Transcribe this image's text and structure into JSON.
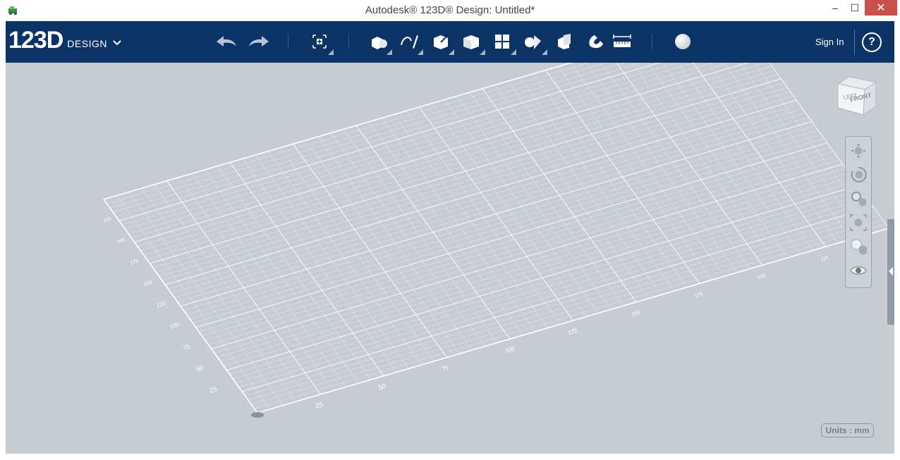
{
  "window": {
    "title": "Autodesk® 123D® Design: Untitled*",
    "controls": {
      "minimize": "–",
      "maximize": "☐",
      "close": "✕"
    }
  },
  "toolbar": {
    "logo": {
      "number": "123D",
      "word": "DESIGN"
    },
    "tools": [
      {
        "name": "undo-button",
        "icon": "undo-arrow-icon"
      },
      {
        "name": "redo-button",
        "icon": "redo-arrow-icon"
      },
      {
        "name": "transform-button",
        "icon": "transform-icon"
      },
      {
        "name": "primitives-button",
        "icon": "primitives-icon"
      },
      {
        "name": "sketch-button",
        "icon": "sketch-icon"
      },
      {
        "name": "construct-button",
        "icon": "construct-icon"
      },
      {
        "name": "modify-button",
        "icon": "modify-icon"
      },
      {
        "name": "pattern-button",
        "icon": "pattern-icon"
      },
      {
        "name": "group-button",
        "icon": "group-icon"
      },
      {
        "name": "combine-button",
        "icon": "combine-icon"
      },
      {
        "name": "snap-button",
        "icon": "snap-magnet-icon"
      },
      {
        "name": "measure-button",
        "icon": "ruler-icon"
      },
      {
        "name": "material-button",
        "icon": "sphere-icon"
      }
    ],
    "sign_in": "Sign In",
    "help": "?"
  },
  "viewcube": {
    "face_front": "FRONT",
    "face_left": "LEFT"
  },
  "grid": {
    "axis_left_labels": [
      "25",
      "50",
      "75",
      "100",
      "125",
      "150",
      "175",
      "200",
      "225"
    ],
    "axis_front_labels": [
      "25",
      "50",
      "75",
      "100",
      "125",
      "150",
      "175",
      "200",
      "225"
    ]
  },
  "status": {
    "units": "Units : mm"
  },
  "colors": {
    "toolbar_bg": "#0b3366",
    "viewport_bg": "#c7ccd3",
    "close_btn": "#c7504b"
  }
}
